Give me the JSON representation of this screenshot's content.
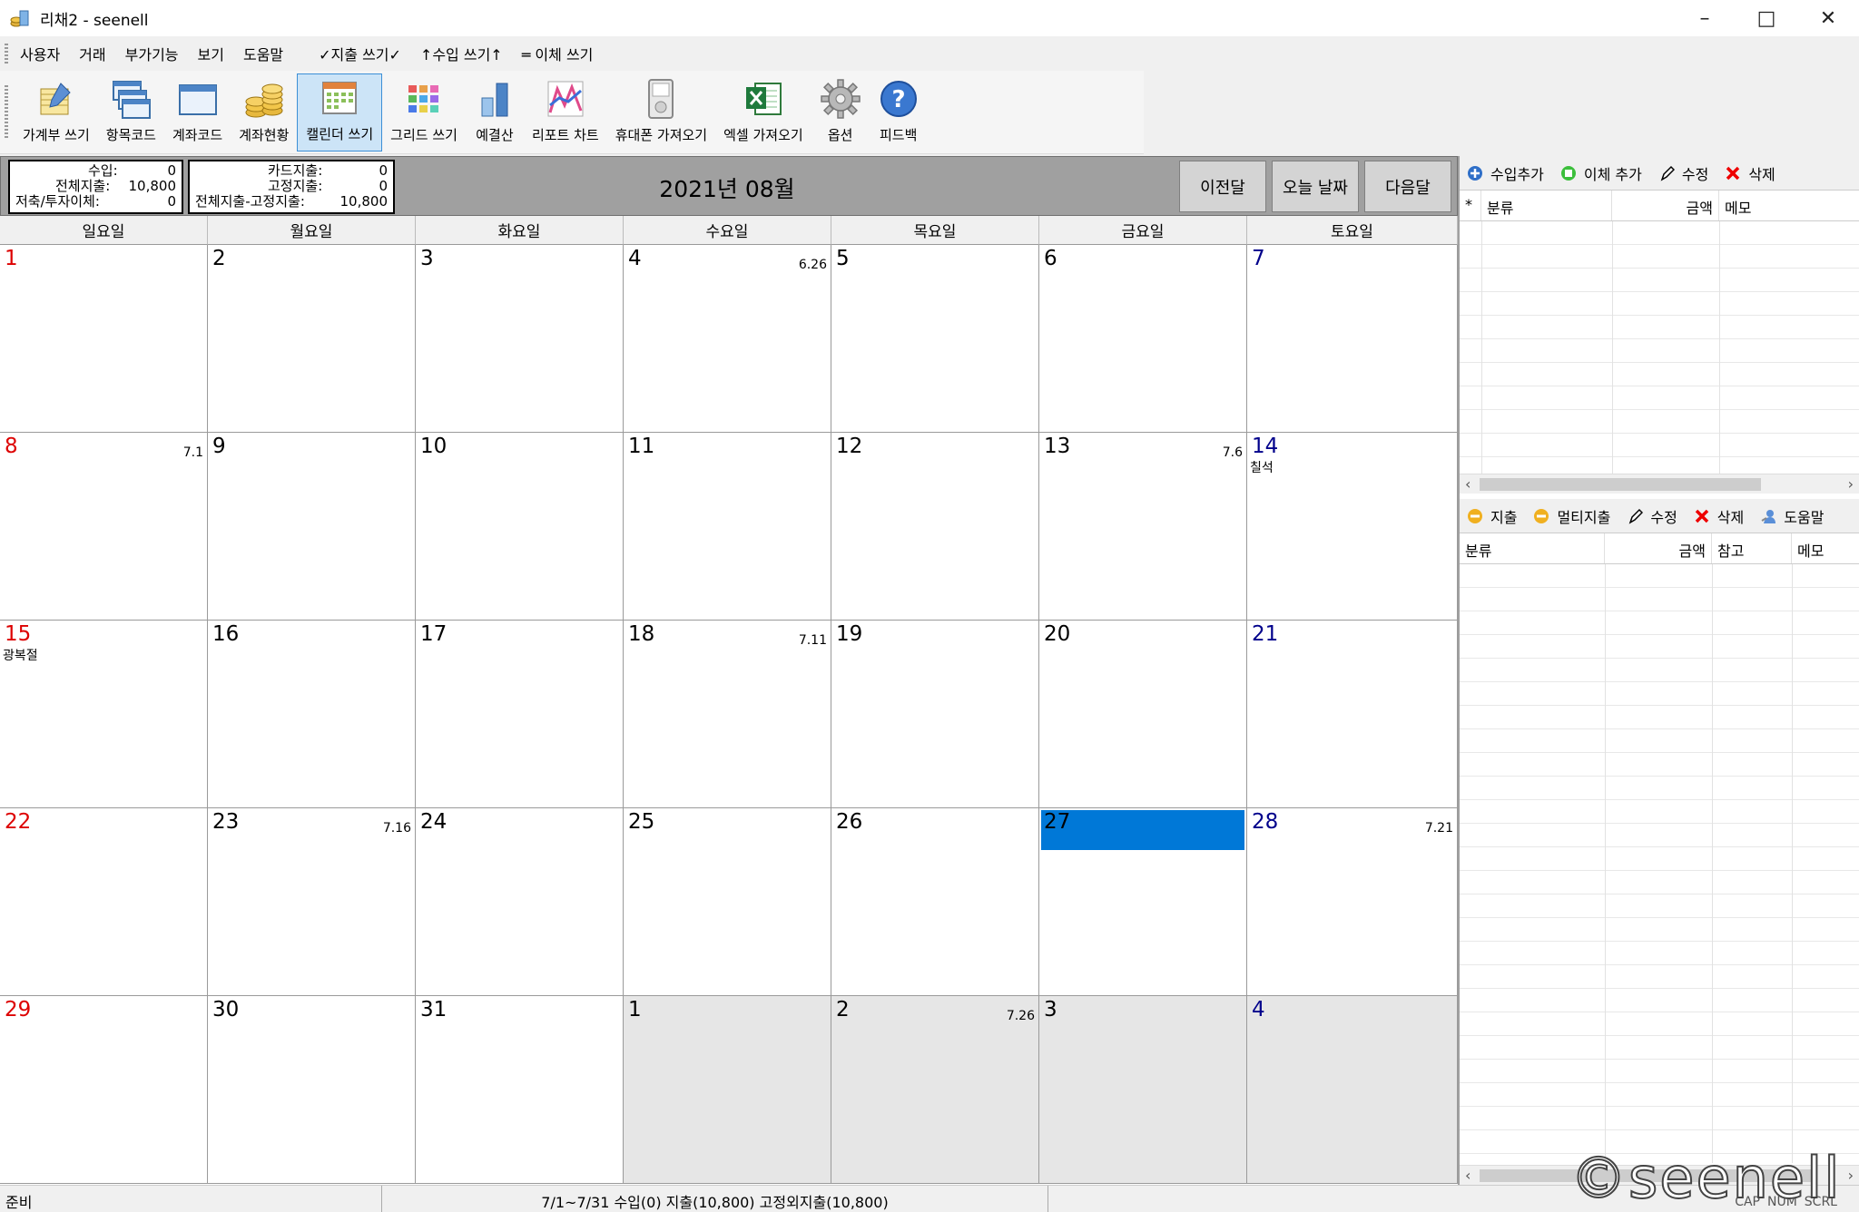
{
  "window": {
    "title": "리채2 - seenell"
  },
  "menu": [
    "사용자",
    "거래",
    "부가기능",
    "보기",
    "도움말"
  ],
  "quick_menu": [
    "✓지출 쓰기✓",
    "↑수입 쓰기↑",
    "═ 이체 쓰기"
  ],
  "toolbar": [
    {
      "label": "가계부 쓰기",
      "icon": "ledger-pen-icon"
    },
    {
      "label": "항목코드",
      "icon": "windows-stack-icon"
    },
    {
      "label": "계좌코드",
      "icon": "window-icon"
    },
    {
      "label": "계좌현황",
      "icon": "coins-icon"
    },
    {
      "label": "캘린더 쓰기",
      "icon": "calendar-icon",
      "active": true
    },
    {
      "label": "그리드 쓰기",
      "icon": "grid-icon"
    },
    {
      "label": "예결산",
      "icon": "bar-chart-icon"
    },
    {
      "label": "리포트 차트",
      "icon": "line-chart-icon"
    },
    {
      "label": "휴대폰 가져오기",
      "icon": "phone-icon"
    },
    {
      "label": "엑셀 가져오기",
      "icon": "excel-icon"
    },
    {
      "label": "옵션",
      "icon": "gear-icon"
    },
    {
      "label": "피드백",
      "icon": "help-icon"
    }
  ],
  "summary1": {
    "rows": [
      {
        "label": "수입:",
        "value": "0"
      },
      {
        "label": "전체지출:",
        "value": "10,800"
      },
      {
        "label": "저축/투자이체:",
        "value": "0"
      }
    ]
  },
  "summary2": {
    "rows": [
      {
        "label": "카드지출:",
        "value": "0"
      },
      {
        "label": "고정지출:",
        "value": "0"
      },
      {
        "label": "전체지출-고정지출:",
        "value": "10,800"
      }
    ]
  },
  "month_title": "2021년 08월",
  "nav": {
    "prev": "이전달",
    "today": "오늘 날짜",
    "next": "다음달"
  },
  "weekdays": [
    "일요일",
    "월요일",
    "화요일",
    "수요일",
    "목요일",
    "금요일",
    "토요일"
  ],
  "weeks": [
    [
      {
        "d": "1"
      },
      {
        "d": "2"
      },
      {
        "d": "3"
      },
      {
        "d": "4",
        "lunar": "6.26"
      },
      {
        "d": "5"
      },
      {
        "d": "6"
      },
      {
        "d": "7"
      }
    ],
    [
      {
        "d": "8",
        "lunar": "7.1"
      },
      {
        "d": "9"
      },
      {
        "d": "10"
      },
      {
        "d": "11"
      },
      {
        "d": "12"
      },
      {
        "d": "13",
        "lunar": "7.6"
      },
      {
        "d": "14",
        "holiday": "칠석"
      }
    ],
    [
      {
        "d": "15",
        "holiday": "광복절"
      },
      {
        "d": "16"
      },
      {
        "d": "17"
      },
      {
        "d": "18",
        "lunar": "7.11"
      },
      {
        "d": "19"
      },
      {
        "d": "20"
      },
      {
        "d": "21"
      }
    ],
    [
      {
        "d": "22"
      },
      {
        "d": "23",
        "lunar": "7.16"
      },
      {
        "d": "24"
      },
      {
        "d": "25"
      },
      {
        "d": "26"
      },
      {
        "d": "27",
        "today": true
      },
      {
        "d": "28",
        "lunar": "7.21"
      }
    ],
    [
      {
        "d": "29"
      },
      {
        "d": "30"
      },
      {
        "d": "31"
      },
      {
        "d": "1",
        "other": true
      },
      {
        "d": "2",
        "lunar": "7.26",
        "other": true
      },
      {
        "d": "3",
        "other": true
      },
      {
        "d": "4",
        "other": true
      }
    ]
  ],
  "income_panel": {
    "tools": [
      "수입추가",
      "이체 추가",
      "수정",
      "삭제"
    ],
    "columns": [
      "*",
      "분류",
      "금액",
      "메모"
    ]
  },
  "expense_panel": {
    "tools": [
      "지출",
      "멀티지출",
      "수정",
      "삭제",
      "도움말"
    ],
    "columns": [
      "분류",
      "금액",
      "참고",
      "메모"
    ]
  },
  "status": {
    "left": "준비",
    "middle": "7/1~7/31 수입(0) 지출(10,800) 고정외지출(10,800)",
    "keys": [
      "CAP",
      "NUM",
      "SCRL"
    ]
  },
  "watermark": "©seenell",
  "colors": {
    "sunday": "#dd0000",
    "saturday": "#00008b",
    "today": "#0078d7"
  }
}
